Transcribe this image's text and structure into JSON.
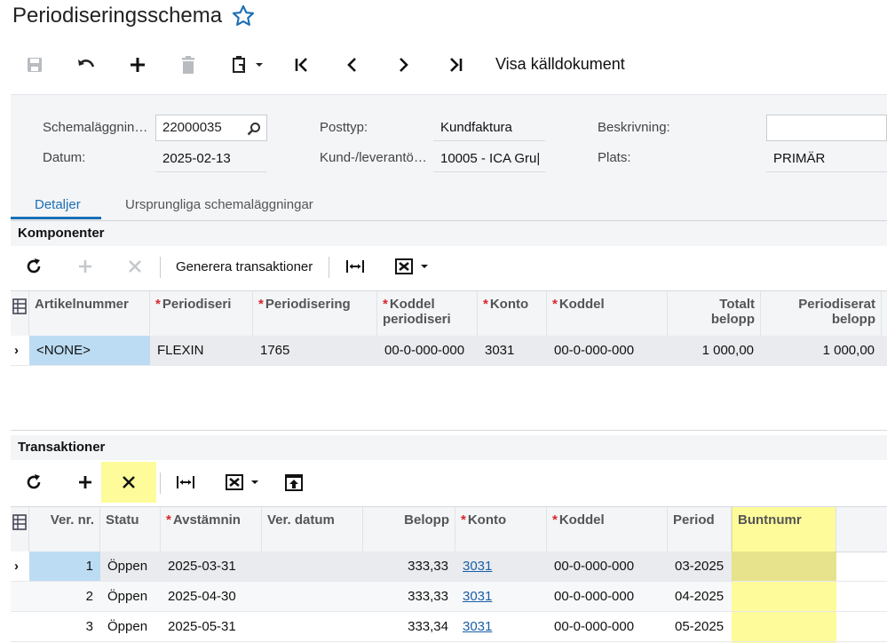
{
  "page": {
    "title": "Periodiseringsschema"
  },
  "toolbar": {
    "save": "save-icon",
    "undo": "undo-icon",
    "add": "plus-icon",
    "delete": "trash-icon",
    "paste": "clipboard-icon",
    "first": "first-icon",
    "prev": "prev-icon",
    "next": "next-icon",
    "last": "last-icon",
    "visa_label": "Visa källdokument"
  },
  "form": {
    "schema_label": "Schemaläggnin…",
    "schema_value": "22000035",
    "datum_label": "Datum:",
    "datum_value": "2025-02-13",
    "posttyp_label": "Posttyp:",
    "posttyp_value": "Kundfaktura",
    "kund_label": "Kund-/leverantö…",
    "kund_value": "10005 - ICA Gru|",
    "beskrivning_label": "Beskrivning:",
    "beskrivning_value": "",
    "plats_label": "Plats:",
    "plats_value": "PRIMÄR"
  },
  "tabs": [
    {
      "label": "Detaljer"
    },
    {
      "label": "Ursprungliga schemaläggningar"
    }
  ],
  "komponenter": {
    "title": "Komponenter",
    "generate_label": "Generera transaktioner",
    "columns": [
      "Artikelnummer",
      "Periodiseri",
      "Periodisering",
      "Koddel periodiseri",
      "Konto",
      "Koddel",
      "Totalt belopp",
      "Periodiserat belopp"
    ],
    "rows": [
      {
        "artikel": "<NONE>",
        "periodiseri": "FLEXIN",
        "periodisering": "1765",
        "koddel_per": "00-0-000-000",
        "konto": "3031",
        "koddel": "00-0-000-000",
        "totalt": "1 000,00",
        "periodiserat": "1 000,00"
      }
    ]
  },
  "transaktioner": {
    "title": "Transaktioner",
    "columns": [
      "Ver. nr.",
      "Statu",
      "Avstämnin",
      "Ver. datum",
      "Belopp",
      "Konto",
      "Koddel",
      "Period",
      "Buntnumr"
    ],
    "rows": [
      {
        "nr": "1",
        "status": "Öppen",
        "avst": "2025-03-31",
        "datum": "",
        "belopp": "333,33",
        "konto": "3031",
        "koddel": "00-0-000-000",
        "period": "03-2025",
        "bunt": ""
      },
      {
        "nr": "2",
        "status": "Öppen",
        "avst": "2025-04-30",
        "datum": "",
        "belopp": "333,33",
        "konto": "3031",
        "koddel": "00-0-000-000",
        "period": "04-2025",
        "bunt": ""
      },
      {
        "nr": "3",
        "status": "Öppen",
        "avst": "2025-05-31",
        "datum": "",
        "belopp": "333,34",
        "konto": "3031",
        "koddel": "00-0-000-000",
        "period": "05-2025",
        "bunt": ""
      }
    ]
  },
  "colors": {
    "accent": "#1a6fb5",
    "required": "#d9252b",
    "highlight": "#fdfb9a",
    "selected": "#bcdcf3"
  }
}
